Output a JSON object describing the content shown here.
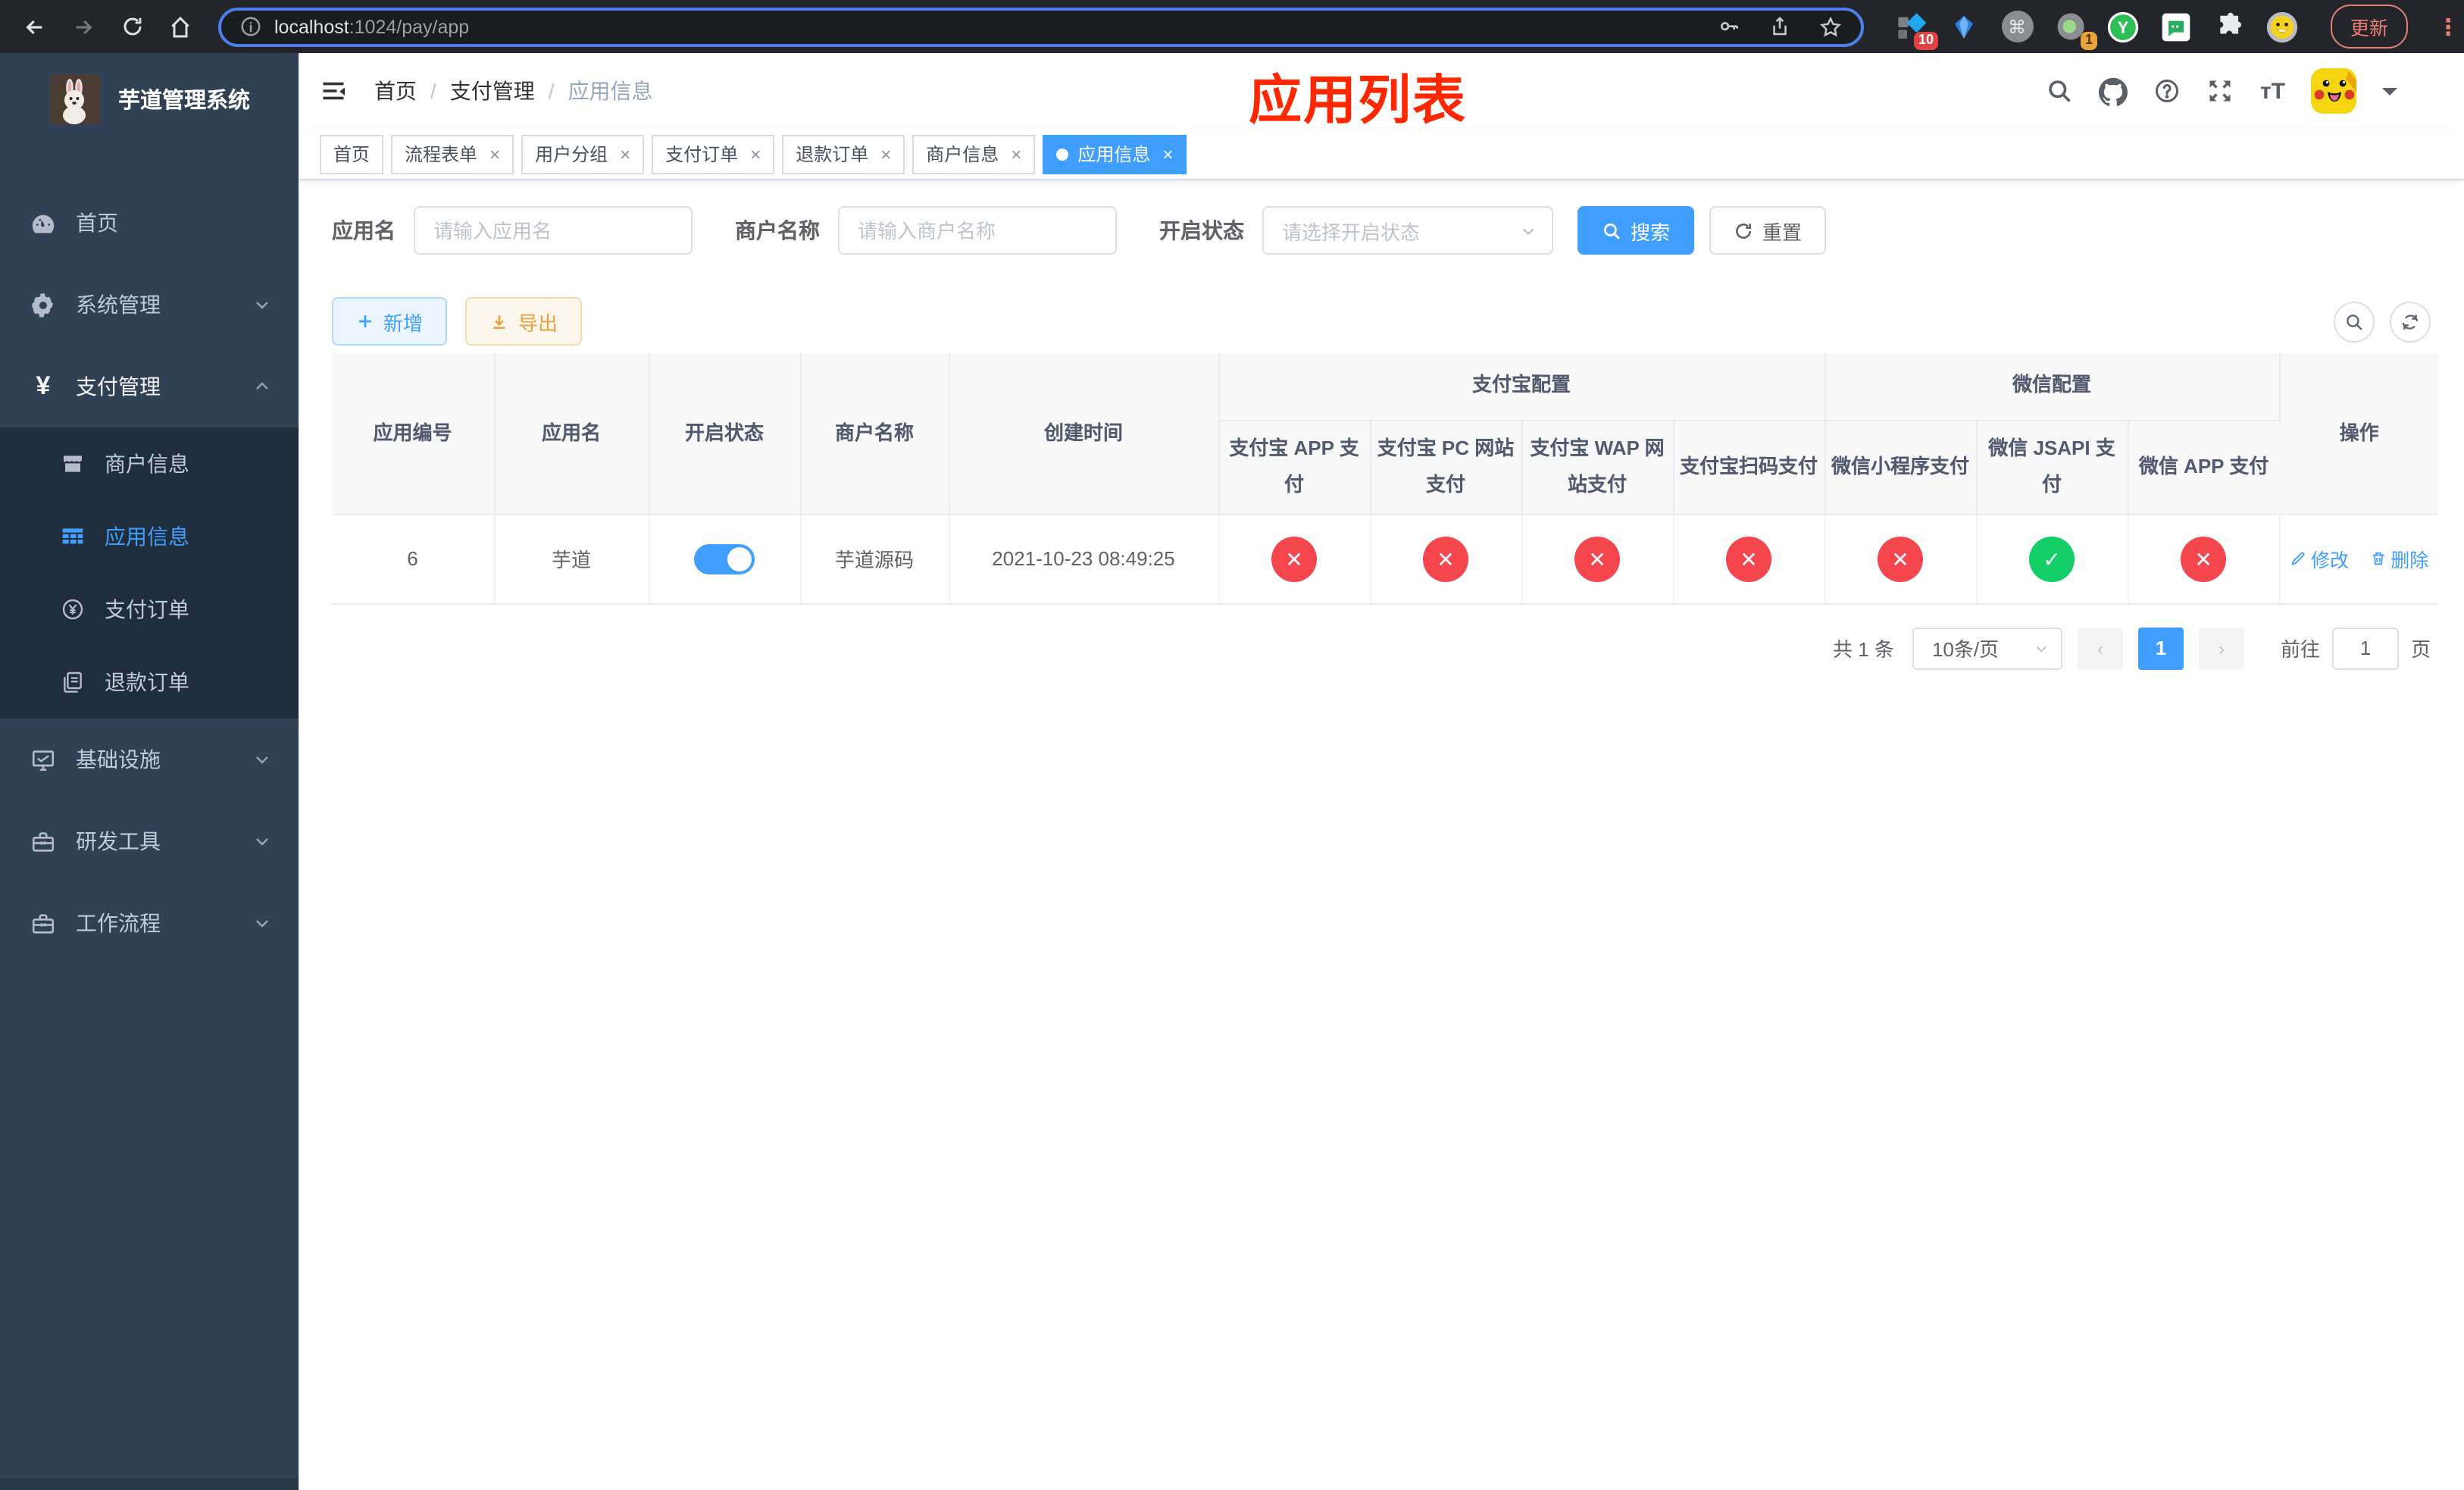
{
  "browser": {
    "url_host": "localhost",
    "url_rest": ":1024/pay/app",
    "ext_badge_ten": "10",
    "ext_badge_one": "1",
    "ext_y_letter": "Y",
    "command_glyph": "⌘",
    "update_label": "更新",
    "menu_dots": "⋮"
  },
  "sidebar": {
    "logo_title": "芋道管理系统",
    "menu": [
      {
        "label": "首页"
      },
      {
        "label": "系统管理"
      },
      {
        "label": "支付管理"
      },
      {
        "label": "基础设施"
      },
      {
        "label": "研发工具"
      },
      {
        "label": "工作流程"
      }
    ],
    "pay_children": [
      {
        "label": "商户信息"
      },
      {
        "label": "应用信息"
      },
      {
        "label": "支付订单"
      },
      {
        "label": "退款订单"
      }
    ]
  },
  "navbar": {
    "breadcrumb": [
      "首页",
      "支付管理",
      "应用信息"
    ],
    "separator": "/",
    "overlay_title": "应用列表"
  },
  "tabs": [
    {
      "label": "首页"
    },
    {
      "label": "流程表单"
    },
    {
      "label": "用户分组"
    },
    {
      "label": "支付订单"
    },
    {
      "label": "退款订单"
    },
    {
      "label": "商户信息"
    },
    {
      "label": "应用信息"
    }
  ],
  "tab_close_glyph": "×",
  "filters": {
    "app_name_label": "应用名",
    "app_name_placeholder": "请输入应用名",
    "merchant_label": "商户名称",
    "merchant_placeholder": "请输入商户名称",
    "status_label": "开启状态",
    "status_placeholder": "请选择开启状态",
    "search_label": "搜索",
    "reset_label": "重置"
  },
  "toolbar": {
    "add_label": "新增",
    "export_label": "导出"
  },
  "table": {
    "group_alipay": "支付宝配置",
    "group_wechat": "微信配置",
    "col_app_id": "应用编号",
    "col_app_name": "应用名",
    "col_status": "开启状态",
    "col_merchant": "商户名称",
    "col_created": "创建时间",
    "col_alipay_app": "支付宝 APP 支付",
    "col_alipay_pc": "支付宝 PC 网站支付",
    "col_alipay_wap": "支付宝 WAP 网站支付",
    "col_alipay_qr": "支付宝扫码支付",
    "col_wx_mini": "微信小程序支付",
    "col_wx_jsapi": "微信 JSAPI 支付",
    "col_wx_app": "微信 APP 支付",
    "col_ops": "操作",
    "glyph_true": "✓",
    "glyph_false": "✕",
    "rows": [
      {
        "id": "6",
        "name": "芋道",
        "enabled": true,
        "merchant": "芋道源码",
        "created": "2021-10-23 08:49:25",
        "alipay_app": false,
        "alipay_pc": false,
        "alipay_wap": false,
        "alipay_qr": false,
        "wx_mini": false,
        "wx_jsapi": true,
        "wx_app": false,
        "edit_label": "修改",
        "delete_label": "删除"
      }
    ]
  },
  "pagination": {
    "total_text": "共 1 条",
    "page_size_text": "10条/页",
    "prev_glyph": "‹",
    "next_glyph": "›",
    "current_page": "1",
    "goto_label": "前往",
    "goto_value": "1",
    "goto_suffix": "页"
  },
  "colors": {
    "accent_blue": "#409eff",
    "danger_red": "#f4464c",
    "success_green": "#13ce66",
    "warn_amber": "#e6a23c",
    "title_red": "#ff2800",
    "sidebar_bg": "#304156",
    "submenu_bg": "#1f2d3d"
  }
}
